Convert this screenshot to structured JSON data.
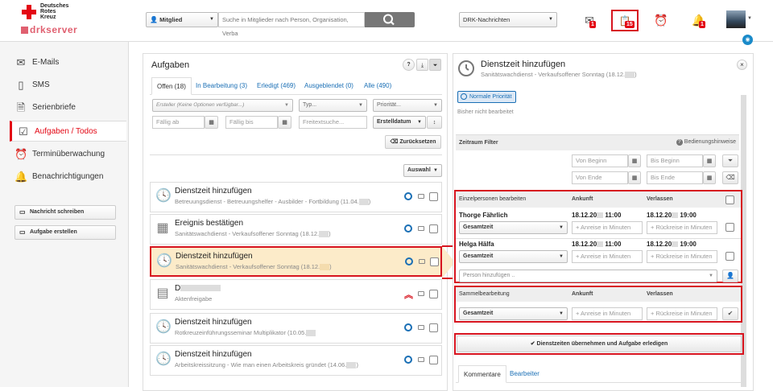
{
  "header": {
    "logo_lines": [
      "Deutsches",
      "Rotes",
      "Kreuz"
    ],
    "logo_server": "drkserver",
    "member_select": "Mitglied",
    "search_placeholder": "Suche in Mitglieder nach Person, Organisation, Verba",
    "news_select": "DRK-Nachrichten",
    "mail_badge": "1",
    "task_badge": "15",
    "bell_badge": "1"
  },
  "nav": {
    "items": [
      {
        "label": "E-Mails",
        "icon": "envelope-icon"
      },
      {
        "label": "SMS",
        "icon": "phone-icon"
      },
      {
        "label": "Serienbriefe",
        "icon": "letters-icon"
      },
      {
        "label": "Aufgaben / Todos",
        "icon": "checklist-icon"
      },
      {
        "label": "Terminüberwachung",
        "icon": "alarm-clock-icon"
      },
      {
        "label": "Benachrichtigungen",
        "icon": "bell-icon"
      }
    ],
    "write_message": "Nachricht schreiben",
    "create_task": "Aufgabe erstellen"
  },
  "tasks_panel": {
    "title": "Aufgaben",
    "tabs": [
      "Offen (18)",
      "In Bearbeitung (3)",
      "Erledigt (469)",
      "Ausgeblendet (0)",
      "Alle (490)"
    ],
    "creator_placeholder": "Ersteller (Keine Optionen verfügbar...)",
    "type_placeholder": "Typ...",
    "priority_placeholder": "Priorität...",
    "due_from": "Fällig ab",
    "due_to": "Fällig bis",
    "freetext": "Freitextsuche...",
    "sort": "Erstelldatum",
    "reset": "Zurücksetzen",
    "selection": "Auswahl",
    "items": [
      {
        "title": "Dienstzeit hinzufügen",
        "sub": "Betreuungsdienst - Betreuungshelfer - Ausbilder - Fortbildung (11.04.",
        "icon": "clock-icon"
      },
      {
        "title": "Ereignis bestätigen",
        "sub": "Sanitätswachdienst - Verkaufsoffener Sonntag (18.12.",
        "icon": "calendar-icon"
      },
      {
        "title": "Dienstzeit hinzufügen",
        "sub": "Sanitätswachdienst - Verkaufsoffener Sonntag (18.12.",
        "icon": "clock-icon"
      },
      {
        "title": "D",
        "sub": "Aktenfreigabe",
        "icon": "id-card-icon"
      },
      {
        "title": "Dienstzeit hinzufügen",
        "sub": "Rotkreuzeinführungsseminar Multiplikator (10.05.",
        "icon": "clock-icon"
      },
      {
        "title": "Dienstzeit hinzufügen",
        "sub": "Arbeitskreissitzung - Wie man einen Arbeitskreis gründet (14.06.",
        "icon": "clock-icon"
      }
    ]
  },
  "detail": {
    "title": "Dienstzeit hinzufügen",
    "subtitle": "Sanitätswachdienst - Verkaufsoffener Sonntag (18.12.",
    "priority": "Normale Priorität",
    "status": "Bisher nicht bearbeitet",
    "time_filter": "Zeitraum Filter",
    "help": "Bedienungshinweise",
    "from_start": "Von Beginn",
    "to_start": "Bis Beginn",
    "from_end": "Von Ende",
    "to_end": "Bis Ende",
    "individual_header": "Einzelpersonen bearbeiten",
    "arrival": "Ankunft",
    "leave": "Verlassen",
    "people": [
      {
        "name": "Thorge Fährlich",
        "arrive_date": "18.12.20",
        "arrive_time": "11:00",
        "leave_date": "18.12.20",
        "leave_time": "19:00"
      },
      {
        "name": "Helga Hälfa",
        "arrive_date": "18.12.20",
        "arrive_time": "11:00",
        "leave_date": "18.12.20",
        "leave_time": "19:00"
      }
    ],
    "total_time": "Gesamtzeit",
    "arrival_minutes": "+ Anreise in Minuten",
    "return_minutes": "+ Rückreise in Minuten",
    "add_person": "Person hinzufügen ..",
    "bulk_header": "Sammelbearbeitung",
    "submit": "Dienstzeiten übernehmen und Aufgabe erledigen",
    "bottom_tabs": [
      "Kommentare",
      "Bearbeiter"
    ]
  }
}
